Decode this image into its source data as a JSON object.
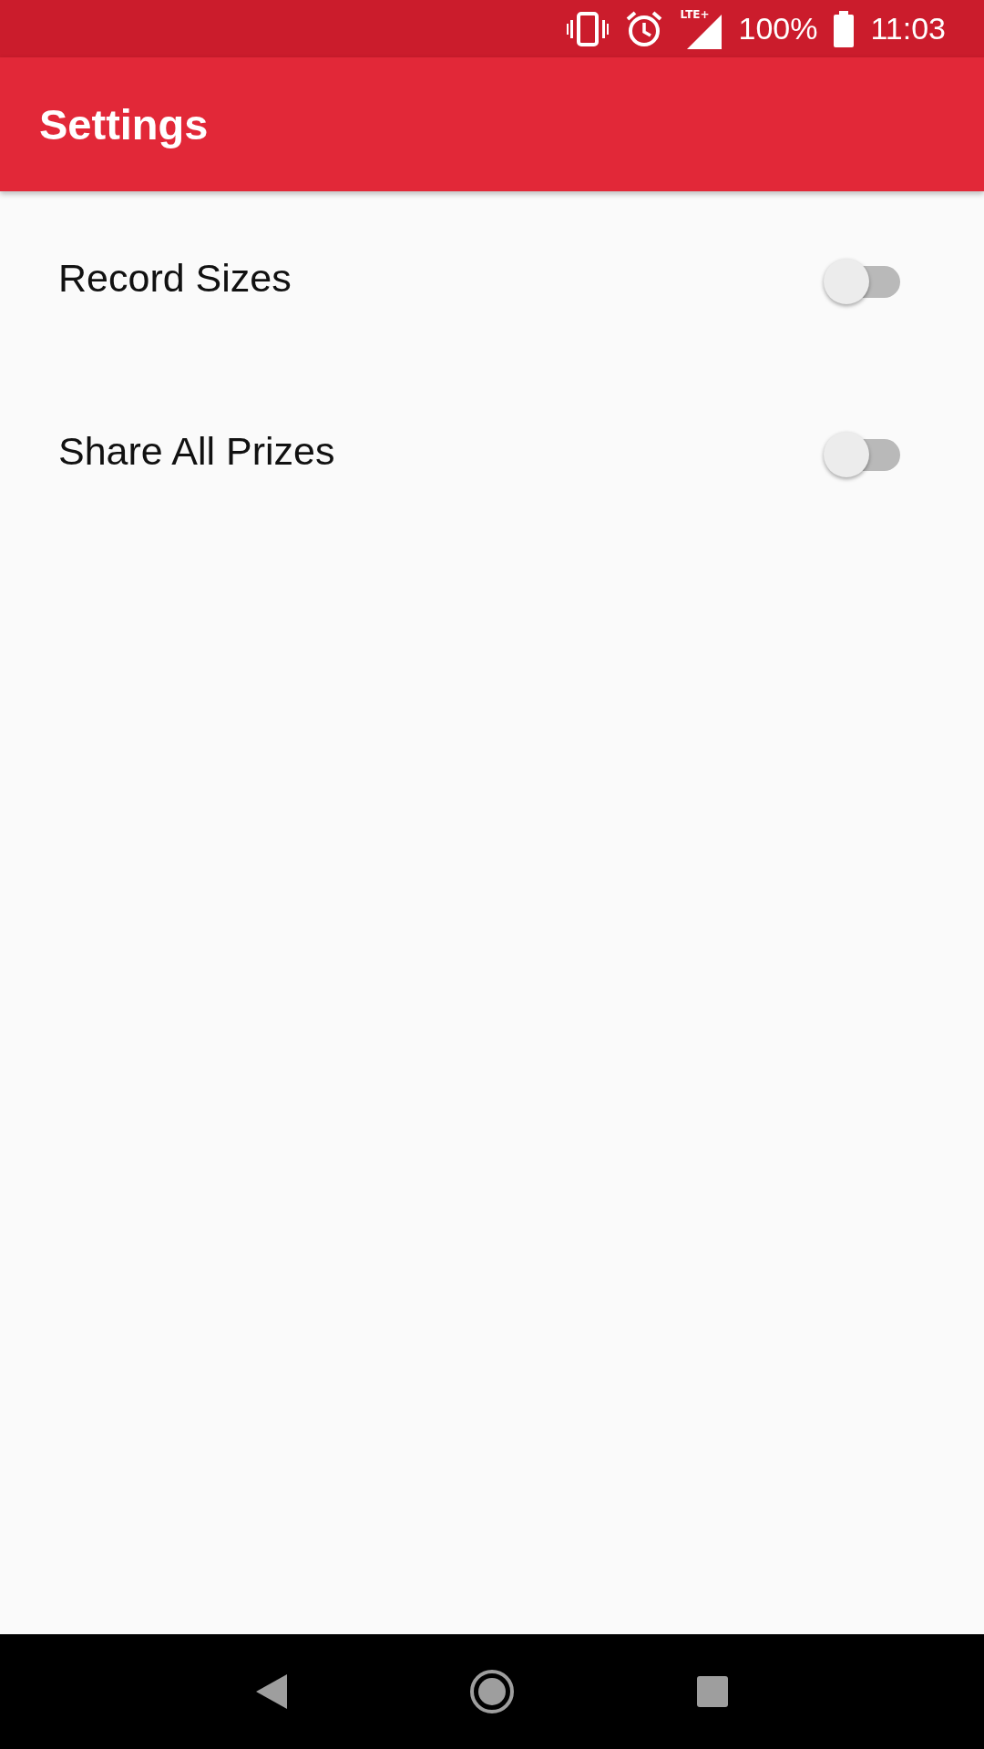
{
  "status_bar": {
    "lte": "LTE+",
    "battery": "100%",
    "time": "11:03"
  },
  "app_bar": {
    "title": "Settings"
  },
  "settings": [
    {
      "label": "Record Sizes",
      "on": false
    },
    {
      "label": "Share All Prizes",
      "on": false
    }
  ]
}
